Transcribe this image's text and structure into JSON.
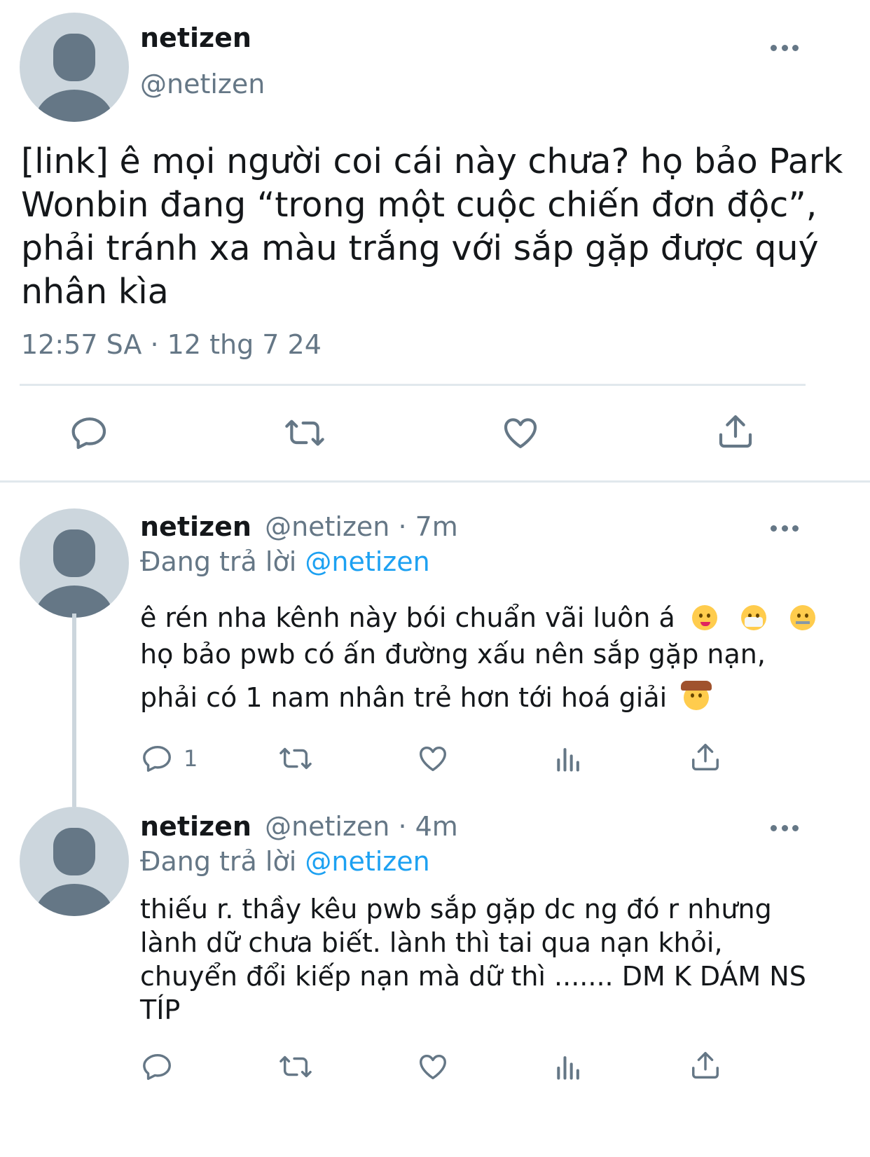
{
  "main_tweet": {
    "name": "netizen",
    "handle": "@netizen",
    "text": "[link] ê mọi người coi cái này chưa? họ bảo Park Wonbin đang “trong một cuộc chiến đơn độc”, phải tránh xa màu trắng với sắp gặp được quý nhân kìa",
    "timestamp": "12:57 SA · 12 thg 7 24",
    "actions": [
      "reply-icon",
      "retweet-icon",
      "like-icon",
      "share-icon"
    ]
  },
  "replies": [
    {
      "name": "netizen",
      "meta": "@netizen · 7m",
      "replying_prefix": "Đang trả lời ",
      "replying_to": "@netizen",
      "line1": "ê rén nha kênh này bói chuẩn vãi luôn á",
      "line2": "họ bảo pwb có ấn đường xấu nên sắp gặp nạn,",
      "line3": "phải có 1 nam nhân trẻ hơn tới hoá giải",
      "emojis": [
        "woozy-face",
        "face-with-medical-mask",
        "zipper-mouth-face",
        "cowboy-hat-face"
      ],
      "reply_count": "1"
    },
    {
      "name": "netizen",
      "meta": "@netizen · 4m",
      "replying_prefix": "Đang trả lời ",
      "replying_to": "@netizen",
      "text": "thiếu r. thầy kêu pwb sắp gặp dc ng đó r nhưng lành dữ chưa biết. lành thì tai qua nạn khỏi, chuyển đổi kiếp nạn mà dữ thì ....... DM K DÁM NS TÍP"
    }
  ]
}
